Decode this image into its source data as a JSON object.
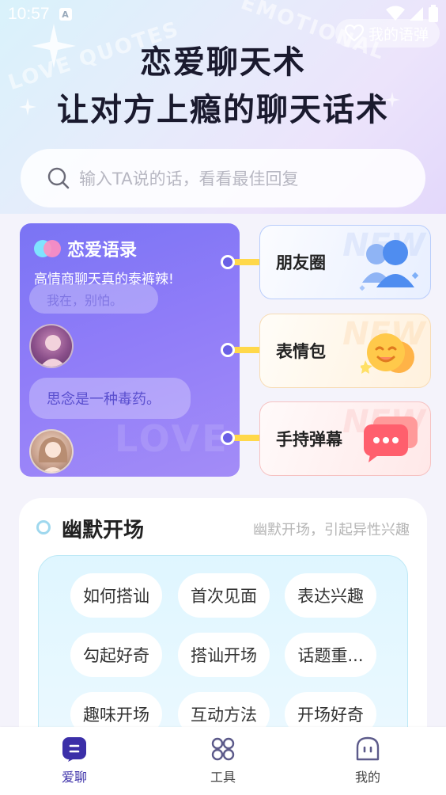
{
  "status_bar": {
    "time": "10:57",
    "notification_letter": "A"
  },
  "header": {
    "my_quotes_label": "我的语弹",
    "title_line1": "恋爱聊天术",
    "title_line2": "让对方上瘾的聊天话术",
    "watermarks": [
      "LOVE QUOTES",
      "EMOTIONAL"
    ]
  },
  "search": {
    "placeholder": "输入TA说的话，看看最佳回复"
  },
  "quotes_card": {
    "title": "恋爱语录",
    "subtitle": "高情商聊天真的泰裤辣!",
    "bubble_top": "我在，别怕。",
    "bubble_bottom": "思念是一种毒药。",
    "watermark": "LOVE"
  },
  "features": [
    {
      "label": "朋友圈",
      "icon": "chat-people-icon",
      "watermark": "NEW"
    },
    {
      "label": "表情包",
      "icon": "emoji-face-icon",
      "watermark": "NEW"
    },
    {
      "label": "手持弹幕",
      "icon": "message-bubble-icon",
      "watermark": "NEW"
    }
  ],
  "humor": {
    "title": "幽默开场",
    "subtitle": "幽默开场，引起异性兴趣",
    "tags": [
      [
        "如何搭讪",
        "首次见面",
        "表达兴趣"
      ],
      [
        "勾起好奇",
        "搭讪开场",
        "话题重..."
      ],
      [
        "趣味开场",
        "互动方法",
        "开场好奇"
      ]
    ]
  },
  "nav": {
    "items": [
      {
        "label": "爱聊",
        "icon": "chat-icon",
        "active": true
      },
      {
        "label": "工具",
        "icon": "grid-circles-icon",
        "active": false
      },
      {
        "label": "我的",
        "icon": "profile-icon",
        "active": false
      }
    ]
  },
  "colors": {
    "accent": "#3b2fa8",
    "quotes_card": "#7a74f4",
    "connector_bar": "#ffd84a"
  }
}
